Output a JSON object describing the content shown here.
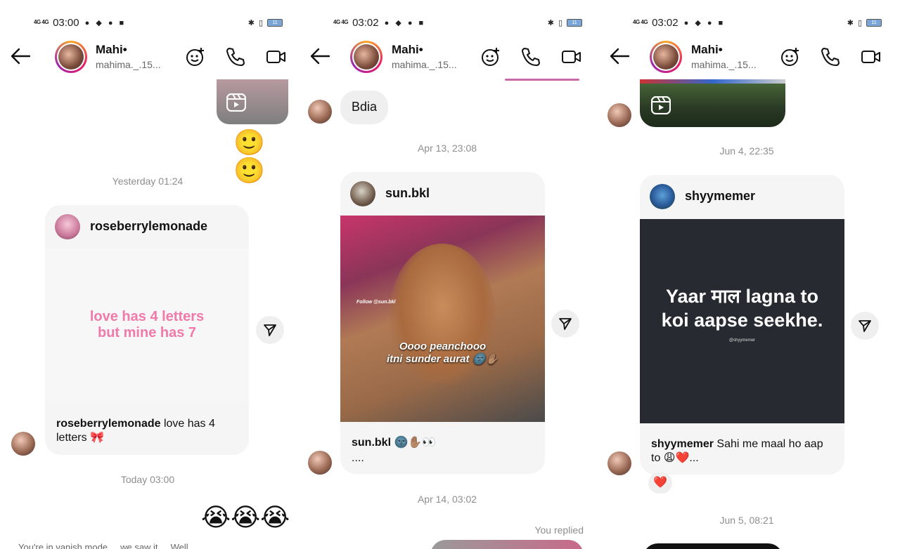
{
  "status": [
    {
      "net": "4G 4G",
      "time": "03:00",
      "battery": "11"
    },
    {
      "net": "4G 4G",
      "time": "03:02",
      "battery": "11"
    },
    {
      "net": "4G 4G",
      "time": "03:02",
      "battery": "11"
    }
  ],
  "header": {
    "name": "Mahi•",
    "username": "mahima._.15..."
  },
  "panel1": {
    "emoji_row1": "🙂🙂",
    "ts1": "Yesterday 01:24",
    "card": {
      "user": "roseberrylemonade",
      "text": "love has 4 letters\nbut mine has 7",
      "cap_user": "roseberrylemonade",
      "cap_text": " love has 4 letters 🎀"
    },
    "ts2": "Today 03:00",
    "emoji_row2": "😭😭😭",
    "footer_text": "You're in vanish mode ... we saw it ... Well"
  },
  "panel2": {
    "bubble": "Bdia",
    "ts1": "Apr 13, 23:08",
    "card": {
      "user": "sun.bkl",
      "follow": "Follow @sun.bkl",
      "overlay": "Oooo peanchooo\nitni sunder aurat 🌚✋🏽",
      "cap_user": "sun.bkl",
      "cap_text": " 🌚✋🏽👀",
      "cap_more": "...."
    },
    "ts2": "Apr 14, 03:02",
    "replied": "You replied"
  },
  "panel3": {
    "ts1": "Jun 4, 22:35",
    "card": {
      "user": "shyymemer",
      "meme": "Yaar माल lagna to\nkoi aapse seekhe.",
      "meme_small": "@shyymemer",
      "cap_user": "shyymemer",
      "cap_text": " Sahi me maal ho aap to 😩❤️..."
    },
    "reaction": "❤️",
    "ts2": "Jun 5, 08:21"
  },
  "colors": {
    "pink_text": "#f07aa8",
    "meme_bg": "#272a30"
  }
}
